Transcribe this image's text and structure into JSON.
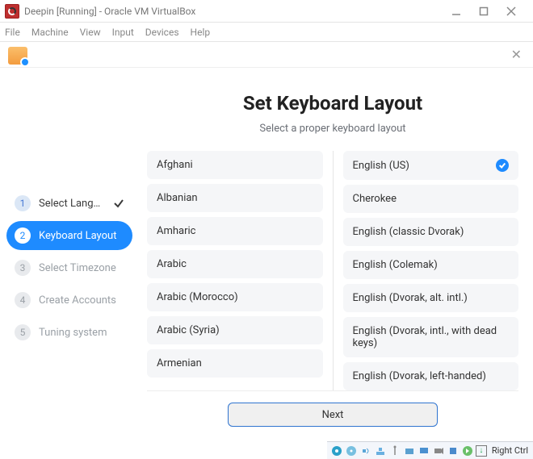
{
  "window": {
    "title": "Deepin [Running] - Oracle VM VirtualBox"
  },
  "menubar": [
    "File",
    "Machine",
    "View",
    "Input",
    "Devices",
    "Help"
  ],
  "sidebar": {
    "steps": [
      {
        "num": "1",
        "label": "Select Langu…",
        "state": "done"
      },
      {
        "num": "2",
        "label": "Keyboard Layout",
        "state": "active"
      },
      {
        "num": "3",
        "label": "Select Timezone",
        "state": "pending"
      },
      {
        "num": "4",
        "label": "Create Accounts",
        "state": "pending"
      },
      {
        "num": "5",
        "label": "Tuning system",
        "state": "pending"
      }
    ]
  },
  "page": {
    "heading": "Set Keyboard Layout",
    "subheading": "Select a proper keyboard layout",
    "next_label": "Next"
  },
  "left_column": [
    "Afghani",
    "Albanian",
    "Amharic",
    "Arabic",
    "Arabic (Morocco)",
    "Arabic (Syria)",
    "Armenian"
  ],
  "right_column": [
    {
      "label": "English (US)",
      "selected": true
    },
    {
      "label": "Cherokee",
      "selected": false
    },
    {
      "label": "English (classic Dvorak)",
      "selected": false
    },
    {
      "label": "English (Colemak)",
      "selected": false
    },
    {
      "label": "English (Dvorak, alt. intl.)",
      "selected": false
    },
    {
      "label": "English (Dvorak, intl., with dead keys)",
      "selected": false
    },
    {
      "label": "English (Dvorak, left-handed)",
      "selected": false
    }
  ],
  "tray": {
    "host_key": "Right Ctrl"
  }
}
